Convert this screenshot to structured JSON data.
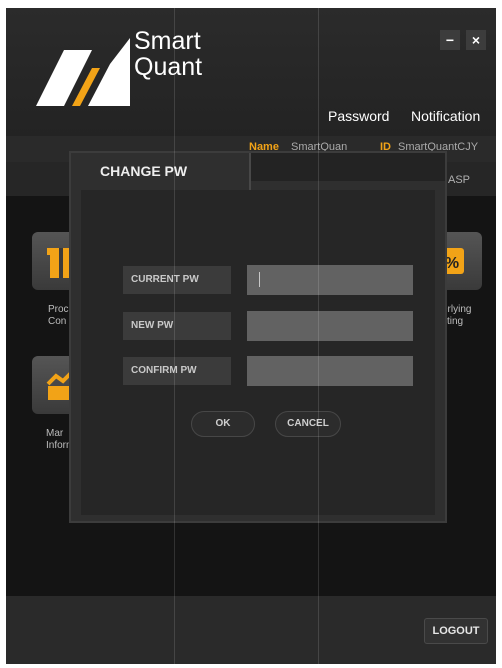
{
  "app": {
    "logo_line1": "Smart",
    "logo_line2": "Quant",
    "brand_color": "#f2a317"
  },
  "window_controls": {
    "minimize": "−",
    "close": "×"
  },
  "top_menu": {
    "password": "Password",
    "notification": "Notification"
  },
  "account": {
    "name_label": "Name",
    "name_value": "SmartQuan",
    "id_label": "ID",
    "id_value": "SmartQuantCJY",
    "sub_info": "ASP"
  },
  "tiles": [
    {
      "label_line1": "Proc",
      "label_line2": "Con",
      "icon": "product-icon"
    },
    {
      "label_line1": "erlying",
      "label_line2": "cting",
      "icon": "percent-tag-icon"
    },
    {
      "label_line1": "Mar",
      "label_line2": "Inform",
      "icon": "market-chart-icon"
    }
  ],
  "dialog": {
    "title": "CHANGE PW",
    "fields": [
      {
        "label": "CURRENT PW",
        "value": ""
      },
      {
        "label": "NEW PW",
        "value": ""
      },
      {
        "label": "CONFIRM PW",
        "value": ""
      }
    ],
    "ok_label": "OK",
    "cancel_label": "CANCEL"
  },
  "footer": {
    "logout_label": "LOGOUT"
  }
}
